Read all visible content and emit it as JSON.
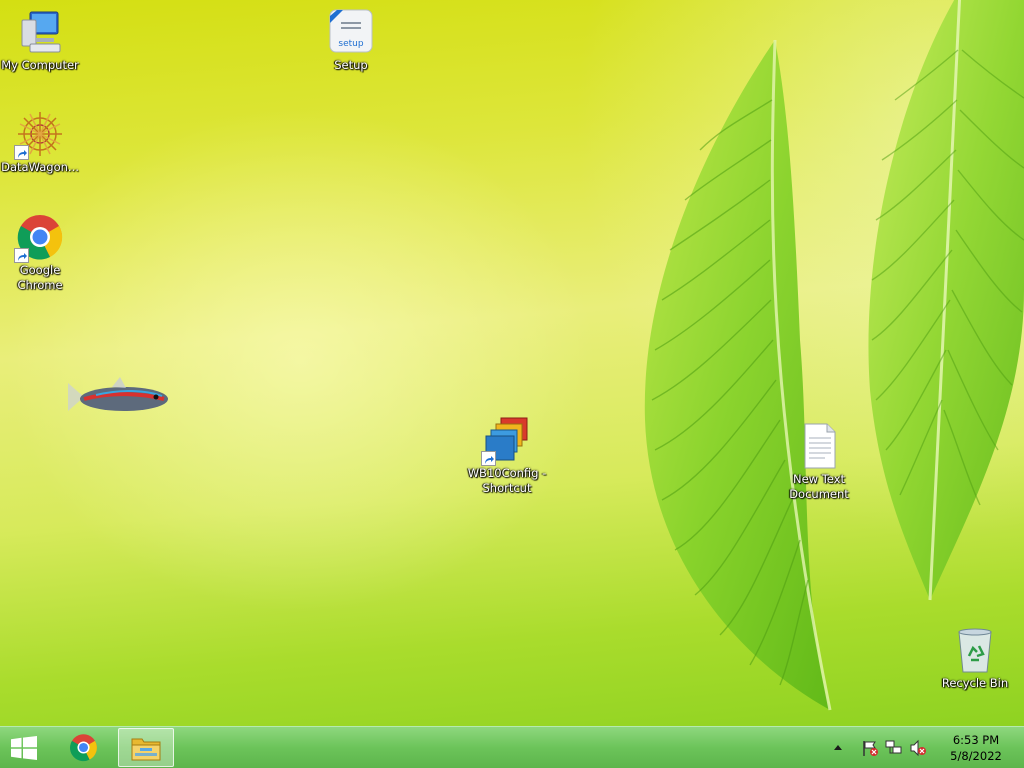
{
  "desktop": {
    "icons": [
      {
        "label": "My Computer",
        "icon": "computer-icon"
      },
      {
        "label": "Setup",
        "icon": "setup-icon"
      },
      {
        "label": "DataWagon...",
        "icon": "datawagon-icon"
      },
      {
        "label": "Google\nChrome",
        "icon": "chrome-icon"
      },
      {
        "label": "WB10Config -\nShortcut",
        "icon": "wb10config-icon"
      },
      {
        "label": "New Text\nDocument",
        "icon": "text-document-icon"
      },
      {
        "label": "Recycle Bin",
        "icon": "recycle-bin-icon"
      }
    ]
  },
  "taskbar": {
    "start_icon": "windows-logo-icon",
    "pinned": [
      {
        "icon": "chrome-icon"
      },
      {
        "icon": "file-explorer-icon"
      }
    ],
    "tray": {
      "icons": [
        "show-hidden-icons-chevron-icon",
        "action-center-flag-icon",
        "network-icon",
        "volume-muted-icon"
      ]
    },
    "clock": {
      "time": "6:53 PM",
      "date": "5/8/2022"
    }
  },
  "colors": {
    "taskbar": "#6cc45a",
    "wallpaper_top": "#d4df12",
    "wallpaper_bottom": "#86cf1e"
  }
}
